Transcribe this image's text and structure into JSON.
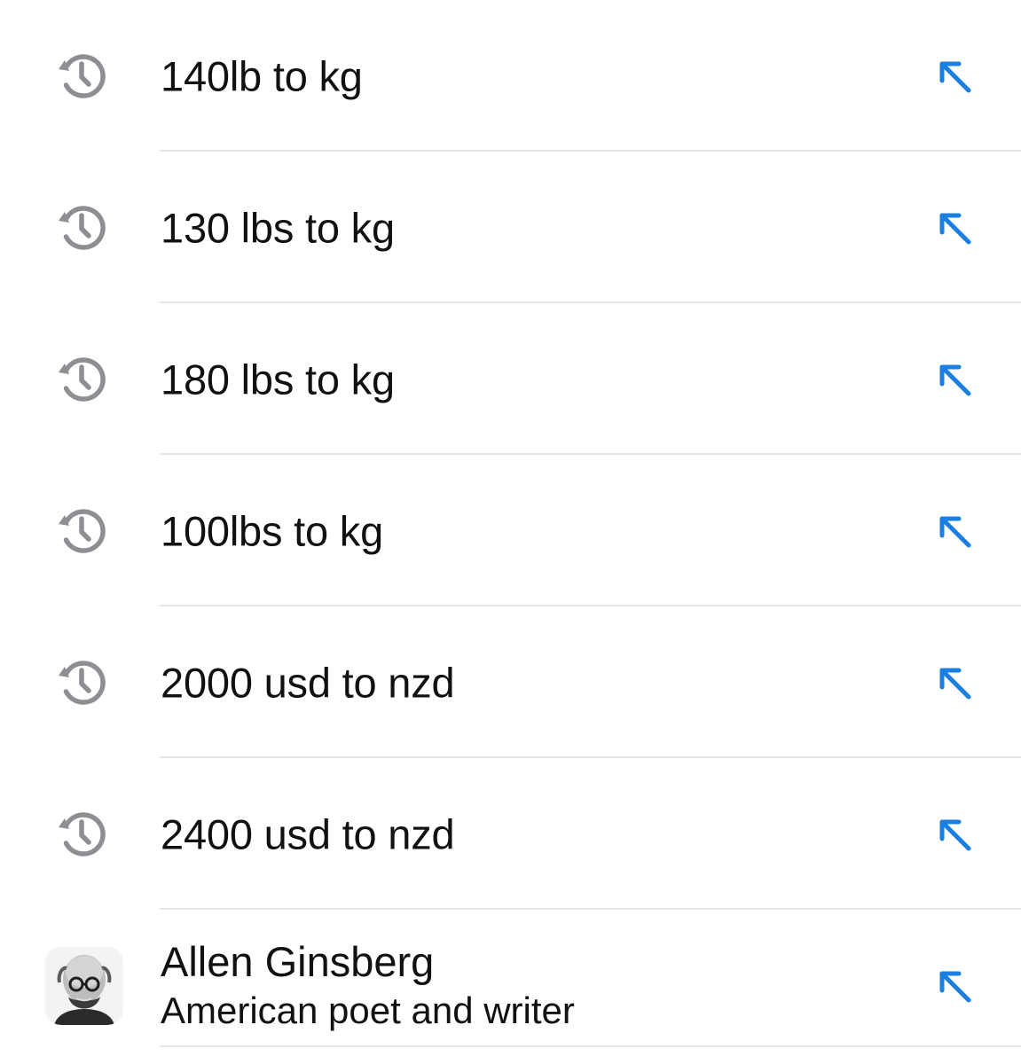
{
  "colors": {
    "history_icon": "#8e8e93",
    "fill_arrow": "#1a7fe0",
    "divider": "#e6e6e8",
    "text": "#111111"
  },
  "suggestions": [
    {
      "icon": "history-clock-icon",
      "label": "140lb to kg",
      "action_icon": "arrow-up-left-icon"
    },
    {
      "icon": "history-clock-icon",
      "label": "130 lbs to kg",
      "action_icon": "arrow-up-left-icon"
    },
    {
      "icon": "history-clock-icon",
      "label": "180 lbs to kg",
      "action_icon": "arrow-up-left-icon"
    },
    {
      "icon": "history-clock-icon",
      "label": "100lbs to kg",
      "action_icon": "arrow-up-left-icon"
    },
    {
      "icon": "history-clock-icon",
      "label": "2000 usd to nzd",
      "action_icon": "arrow-up-left-icon"
    },
    {
      "icon": "history-clock-icon",
      "label": "2400 usd to nzd",
      "action_icon": "arrow-up-left-icon"
    }
  ],
  "entity": {
    "icon": "avatar-photo",
    "title": "Allen Ginsberg",
    "subtitle": "American poet and writer",
    "action_icon": "arrow-up-left-icon"
  }
}
